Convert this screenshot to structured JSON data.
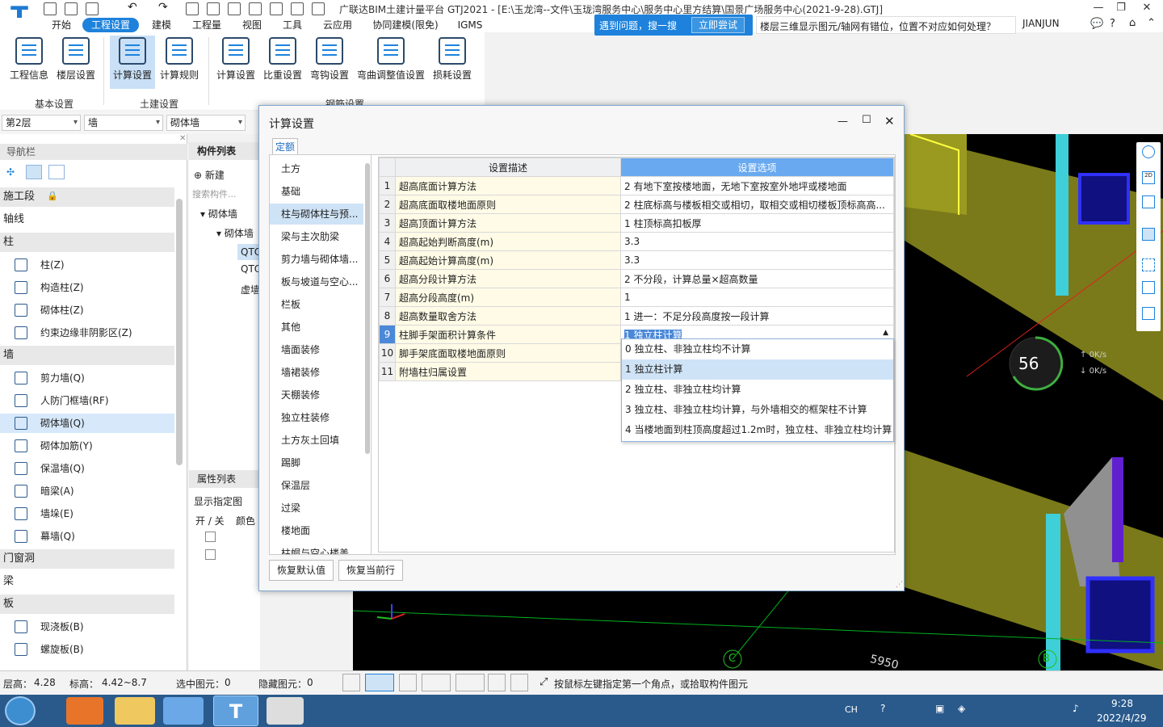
{
  "window": {
    "title": "广联达BIM土建计量平台 GTJ2021 - [E:\\玉龙湾--文件\\玉珑湾服务中心\\服务中心里方结算\\国景广场服务中心(2021-9-28).GTJ]"
  },
  "menu": [
    "开始",
    "工程设置",
    "建模",
    "工程量",
    "视图",
    "工具",
    "云应用",
    "协同建模(限免)",
    "IGMS"
  ],
  "ribbon": {
    "buttons": [
      "工程信息",
      "楼层设置",
      "计算设置",
      "计算规则",
      "计算设置",
      "比重设置",
      "弯钩设置",
      "弯曲调整值设置",
      "损耗设置"
    ],
    "groups": [
      "基本设置",
      "土建设置",
      "钢筋设置"
    ]
  },
  "help": {
    "prompt": "遇到问题，搜一搜",
    "action": "立即尝试",
    "search_text": "楼层三维显示图元/轴网有错位，位置不对应如何处理？"
  },
  "user": {
    "name": "JIANJUN"
  },
  "filters": {
    "floor": "第2层",
    "type": "墙",
    "subtype": "砌体墙"
  },
  "nav": {
    "title": "导航栏",
    "categories": [
      "施工段",
      "轴线",
      "柱",
      "墙",
      "门窗洞",
      "梁",
      "板"
    ],
    "col_items": [
      "柱(Z)",
      "构造柱(Z)",
      "砌体柱(Z)",
      "约束边缘非阴影区(Z)"
    ],
    "wall_items": [
      "剪力墙(Q)",
      "人防门框墙(RF)",
      "砌体墙(Q)",
      "砌体加筋(Y)",
      "保温墙(Q)",
      "暗梁(A)",
      "墙垛(E)",
      "幕墙(Q)"
    ],
    "slab_items": [
      "现浇板(B)",
      "螺旋板(B)"
    ]
  },
  "components": {
    "tab": "构件列表",
    "new": "新建",
    "search": "搜索构件...",
    "tree": [
      "砌体墙",
      "砌体墙",
      "QTQ",
      "QTQ",
      "虚墙"
    ],
    "props_tab": "属性列表",
    "show_label": "显示指定图",
    "col_onoff": "开 / 关",
    "col_color": "颜色"
  },
  "dialog": {
    "title": "计算设置",
    "tab": "定额",
    "categories": [
      "土方",
      "基础",
      "柱与砌体柱与预...",
      "梁与主次肋梁",
      "剪力墙与砌体墙...",
      "板与坡道与空心...",
      "栏板",
      "其他",
      "墙面装修",
      "墙裙装修",
      "天棚装修",
      "独立柱装修",
      "土方灰土回填",
      "踢脚",
      "保温层",
      "过梁",
      "楼地面",
      "柱帽与空心楼盖"
    ],
    "columns": [
      "设置描述",
      "设置选项"
    ],
    "rows": [
      {
        "n": "1",
        "desc": "超高底面计算方法",
        "val": "2 有地下室按楼地面，无地下室按室外地坪或楼地面"
      },
      {
        "n": "2",
        "desc": "超高底面取楼地面原则",
        "val": "2 柱底标高与楼板相交或相切，取相交或相切楼板顶标高高..."
      },
      {
        "n": "3",
        "desc": "超高顶面计算方法",
        "val": "1 柱顶标高扣板厚"
      },
      {
        "n": "4",
        "desc": "超高起始判断高度(m)",
        "val": "3.3"
      },
      {
        "n": "5",
        "desc": "超高起始计算高度(m)",
        "val": "3.3"
      },
      {
        "n": "6",
        "desc": "超高分段计算方法",
        "val": "2 不分段，计算总量×超高数量"
      },
      {
        "n": "7",
        "desc": "超高分段高度(m)",
        "val": "1"
      },
      {
        "n": "8",
        "desc": "超高数量取舍方法",
        "val": "1 进一：不足分段高度按一段计算"
      },
      {
        "n": "9",
        "desc": "柱脚手架面积计算条件",
        "val": "1 独立柱计算"
      },
      {
        "n": "10",
        "desc": "脚手架底面取楼地面原则",
        "val": ""
      },
      {
        "n": "11",
        "desc": "附墙柱归属设置",
        "val": ""
      }
    ],
    "dropdown": [
      "0 独立柱、非独立柱均不计算",
      "1 独立柱计算",
      "2 独立柱、非独立柱均计算",
      "3 独立柱、非独立柱均计算，与外墙相交的框架柱不计算",
      "4 当楼地面到柱顶高度超过1.2m时，独立柱、非独立柱均计算"
    ],
    "buttons": [
      "恢复默认值",
      "恢复当前行"
    ]
  },
  "cad": {
    "axis_labels": [
      "C",
      "B"
    ],
    "dimension": "5950",
    "progress": "56",
    "net_up": "0",
    "net_down": "0",
    "net_unit": "K/s"
  },
  "status": {
    "floor_h_label": "层高：",
    "floor_h": "4.28",
    "elev_label": "标高：",
    "elev": "4.42~8.7",
    "sel_label": "选中图元：",
    "sel": "0",
    "hidden_label": "隐藏图元：",
    "hidden": "0",
    "hint": "按鼠标左键指定第一个角点，或拾取构件图元"
  },
  "taskbar": {
    "lang": "CH",
    "time": "9:28",
    "date": "2022/4/29"
  }
}
